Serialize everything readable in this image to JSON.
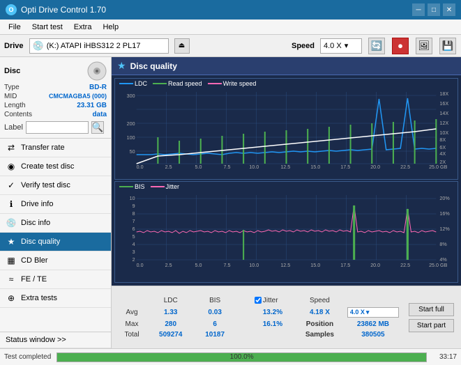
{
  "titlebar": {
    "icon_label": "O",
    "title": "Opti Drive Control 1.70",
    "minimize": "─",
    "maximize": "□",
    "close": "✕"
  },
  "menubar": {
    "items": [
      "File",
      "Start test",
      "Extra",
      "Help"
    ]
  },
  "drivebar": {
    "drive_label": "Drive",
    "drive_value": "(K:)  ATAPI iHBS312  2 PL17",
    "speed_label": "Speed",
    "speed_value": "4.0 X"
  },
  "disc_panel": {
    "title": "Disc",
    "type_key": "Type",
    "type_val": "BD-R",
    "mid_key": "MID",
    "mid_val": "CMCMAGBA5 (000)",
    "length_key": "Length",
    "length_val": "23.31 GB",
    "contents_key": "Contents",
    "contents_val": "data",
    "label_key": "Label",
    "label_placeholder": ""
  },
  "nav": {
    "items": [
      {
        "id": "transfer-rate",
        "label": "Transfer rate",
        "icon": "⇄"
      },
      {
        "id": "create-test-disc",
        "label": "Create test disc",
        "icon": "◉"
      },
      {
        "id": "verify-test-disc",
        "label": "Verify test disc",
        "icon": "✓"
      },
      {
        "id": "drive-info",
        "label": "Drive info",
        "icon": "ℹ"
      },
      {
        "id": "disc-info",
        "label": "Disc info",
        "icon": "📀"
      },
      {
        "id": "disc-quality",
        "label": "Disc quality",
        "icon": "★",
        "active": true
      },
      {
        "id": "cd-bler",
        "label": "CD Bler",
        "icon": "▦"
      },
      {
        "id": "fe-te",
        "label": "FE / TE",
        "icon": "≈"
      },
      {
        "id": "extra-tests",
        "label": "Extra tests",
        "icon": "⊕"
      }
    ]
  },
  "content": {
    "title": "Disc quality",
    "icon": "★",
    "chart1": {
      "legend": [
        "LDC",
        "Read speed",
        "Write speed"
      ],
      "legend_colors": [
        "#2196F3",
        "#4CAF50",
        "#FF69B4"
      ],
      "y_max": 300,
      "y_right_labels": [
        "18X",
        "16X",
        "14X",
        "12X",
        "10X",
        "8X",
        "6X",
        "4X",
        "2X"
      ],
      "x_labels": [
        "0.0",
        "2.5",
        "5.0",
        "7.5",
        "10.0",
        "12.5",
        "15.0",
        "17.5",
        "20.0",
        "22.5",
        "25.0 GB"
      ]
    },
    "chart2": {
      "legend": [
        "BIS",
        "Jitter"
      ],
      "legend_colors": [
        "#4CAF50",
        "#FF69B4"
      ],
      "y_max": 10,
      "y_right_labels": [
        "20%",
        "16%",
        "12%",
        "8%",
        "4%"
      ],
      "x_labels": [
        "0.0",
        "2.5",
        "5.0",
        "7.5",
        "10.0",
        "12.5",
        "15.0",
        "17.5",
        "20.0",
        "22.5",
        "25.0 GB"
      ]
    }
  },
  "stats": {
    "columns": [
      "LDC",
      "BIS",
      "",
      "Jitter",
      "Speed",
      ""
    ],
    "avg_label": "Avg",
    "avg_ldc": "1.33",
    "avg_bis": "0.03",
    "avg_jitter": "13.2%",
    "avg_speed": "4.18 X",
    "avg_speed_sel": "4.0 X",
    "max_label": "Max",
    "max_ldc": "280",
    "max_bis": "6",
    "max_jitter": "16.1%",
    "position_label": "Position",
    "position_val": "23862 MB",
    "total_label": "Total",
    "total_ldc": "509274",
    "total_bis": "10187",
    "samples_label": "Samples",
    "samples_val": "380505",
    "jitter_checked": true,
    "btn_start_full": "Start full",
    "btn_start_part": "Start part"
  },
  "statusbar": {
    "status": "Test completed",
    "progress": 100,
    "progress_text": "100.0%",
    "time": "33:17"
  }
}
